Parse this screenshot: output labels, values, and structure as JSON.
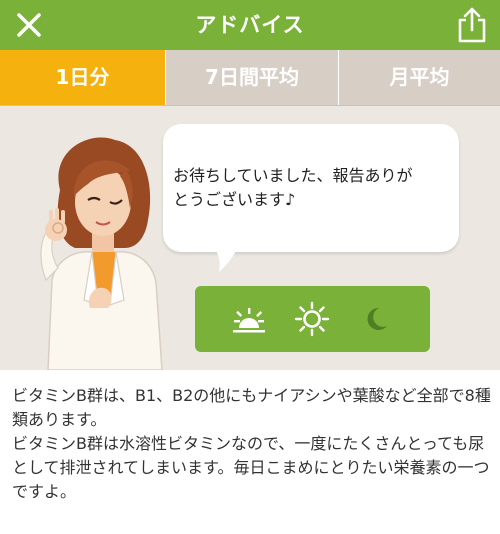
{
  "header": {
    "title": "アドバイス",
    "close_icon": "close-icon",
    "share_icon": "share-icon"
  },
  "tabs": [
    {
      "label": "1日分",
      "active": true
    },
    {
      "label": "7日間平均",
      "active": false
    },
    {
      "label": "月平均",
      "active": false
    }
  ],
  "bubble": {
    "line1": "お待ちしていました、報告ありが",
    "line2": "とうございます♪"
  },
  "time_panel": {
    "icons": [
      "sunrise-icon",
      "sun-icon",
      "moon-icon"
    ]
  },
  "advice": {
    "para1": "ビタミンB群は、B1、B2の他にもナイアシンや葉酸など全部で8種類あります。",
    "para2": "ビタミンB群は水溶性ビタミンなので、一度にたくさんとっても尿として排泄されてしまいます。毎日こまめにとりたい栄養素の一つですよ。"
  },
  "colors": {
    "header_green": "#7ab138",
    "tab_active": "#f5b20f",
    "tab_inactive": "#d7cec6",
    "stage_bg": "#ece8e1"
  }
}
